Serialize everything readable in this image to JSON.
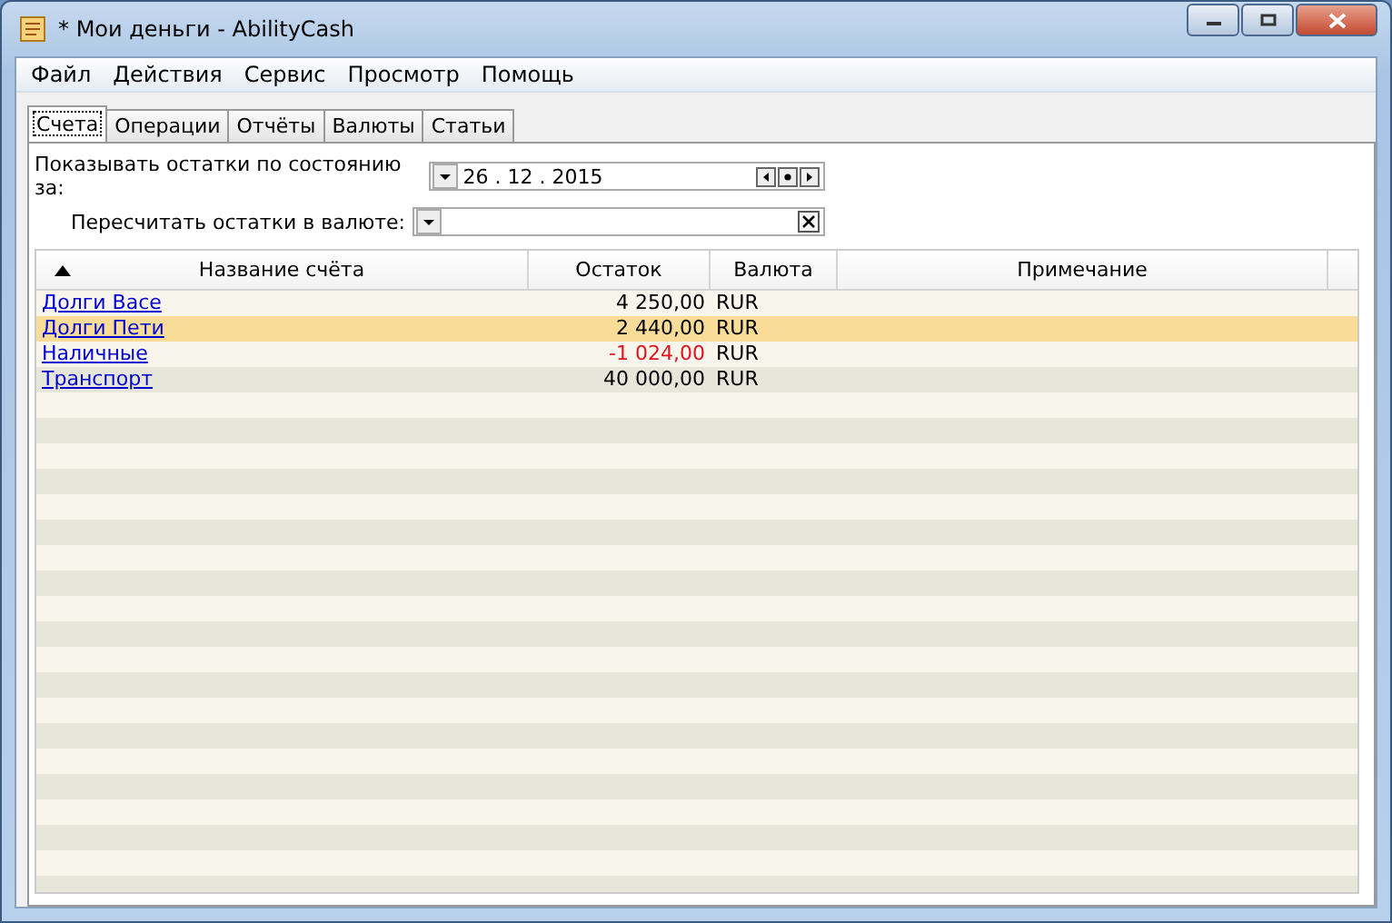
{
  "window": {
    "title": "* Мои деньги - AbilityCash"
  },
  "menu": [
    "Файл",
    "Действия",
    "Сервис",
    "Просмотр",
    "Помощь"
  ],
  "tabs": [
    {
      "label": "Счета",
      "selected": true
    },
    {
      "label": "Операции",
      "selected": false
    },
    {
      "label": "Отчёты",
      "selected": false
    },
    {
      "label": "Валюты",
      "selected": false
    },
    {
      "label": "Статьи",
      "selected": false
    }
  ],
  "filters": {
    "date_label": "Показывать остатки по состоянию за:",
    "date_value": "26 . 12 . 2015",
    "currency_label": "Пересчитать остатки в валюте:"
  },
  "table": {
    "columns": [
      "Название счёта",
      "Остаток",
      "Валюта",
      "Примечание"
    ],
    "rows": [
      {
        "name": "Долги Васе",
        "balance": "4 250,00",
        "currency": "RUR",
        "negative": false,
        "selected": false
      },
      {
        "name": "Долги Пети",
        "balance": "2 440,00",
        "currency": "RUR",
        "negative": false,
        "selected": true
      },
      {
        "name": "Наличные",
        "balance": "-1 024,00",
        "currency": "RUR",
        "negative": true,
        "selected": false
      },
      {
        "name": "Транспорт",
        "balance": "40 000,00",
        "currency": "RUR",
        "negative": false,
        "selected": false
      }
    ]
  }
}
